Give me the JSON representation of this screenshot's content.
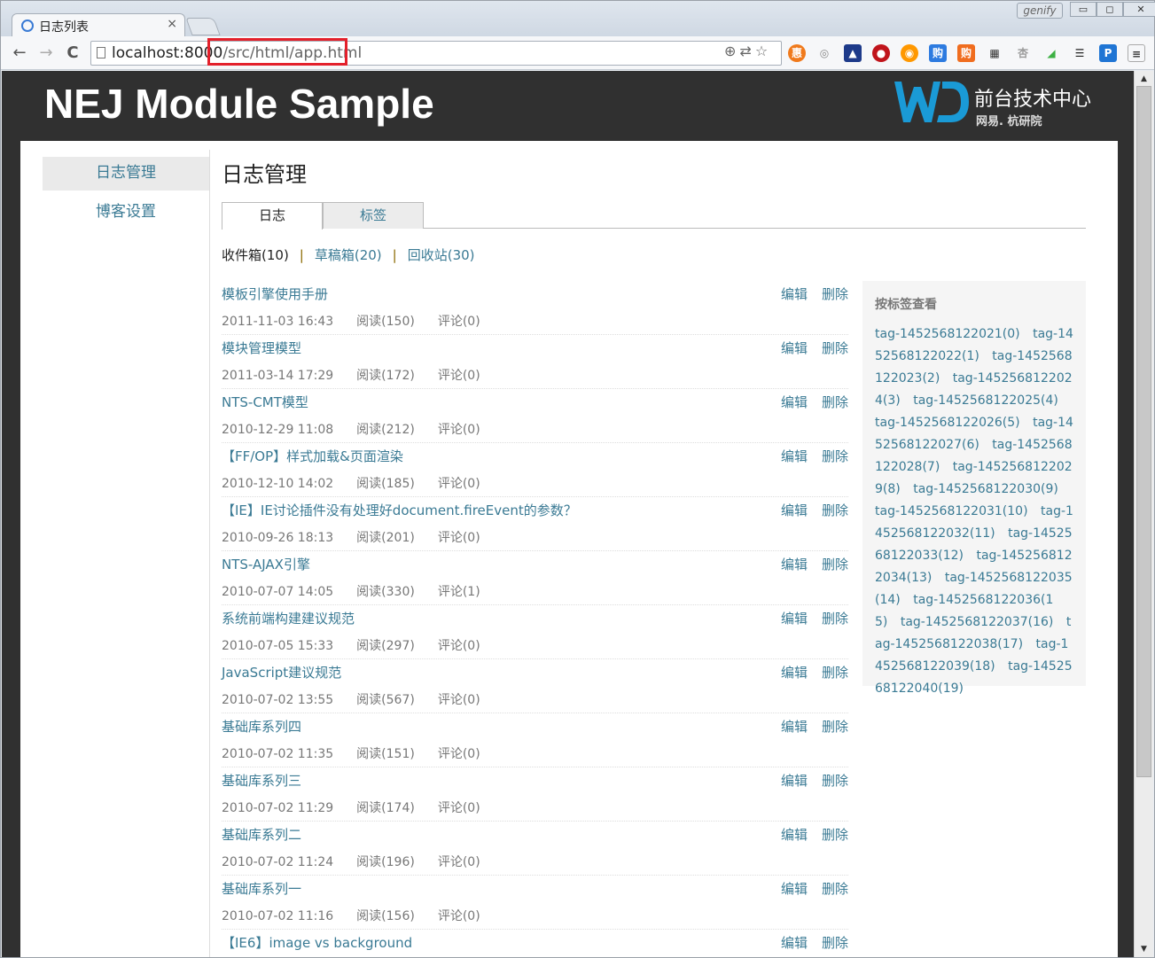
{
  "browser": {
    "tab_title": "日志列表",
    "tab_close": "×",
    "user_badge": "genify",
    "win_min": "▭",
    "win_max": "◻",
    "win_close": "✕",
    "url_host": "localhost:8000",
    "url_path": "/src/html/app.html",
    "back": "←",
    "forward": "→",
    "reload": "C",
    "menu": "≡"
  },
  "banner": {
    "title": "NEJ Module Sample",
    "logo_text": "前台技术中心",
    "logo_sub": "网易. 杭研院"
  },
  "sidebar": {
    "items": [
      {
        "label": "日志管理"
      },
      {
        "label": "博客设置"
      }
    ]
  },
  "main": {
    "title": "日志管理",
    "tabs": [
      {
        "label": "日志"
      },
      {
        "label": "标签"
      }
    ],
    "filters": [
      {
        "label": "收件箱(10)"
      },
      {
        "label": "草稿箱(20)"
      },
      {
        "label": "回收站(30)"
      }
    ],
    "sep": "|",
    "edit_label": "编辑",
    "delete_label": "删除",
    "posts": [
      {
        "title": "模板引擎使用手册",
        "date": "2011-11-03 16:43",
        "reads": "阅读(150)",
        "comments": "评论(0)"
      },
      {
        "title": "模块管理模型",
        "date": "2011-03-14 17:29",
        "reads": "阅读(172)",
        "comments": "评论(0)"
      },
      {
        "title": "NTS-CMT模型",
        "date": "2010-12-29 11:08",
        "reads": "阅读(212)",
        "comments": "评论(0)"
      },
      {
        "title": "【FF/OP】样式加载&页面渲染",
        "date": "2010-12-10 14:02",
        "reads": "阅读(185)",
        "comments": "评论(0)"
      },
      {
        "title": "【IE】IE讨论插件没有处理好document.fireEvent的参数？",
        "date": "2010-09-26 18:13",
        "reads": "阅读(201)",
        "comments": "评论(0)"
      },
      {
        "title": "NTS-AJAX引擎",
        "date": "2010-07-07 14:05",
        "reads": "阅读(330)",
        "comments": "评论(1)"
      },
      {
        "title": "系统前端构建建议规范",
        "date": "2010-07-05 15:33",
        "reads": "阅读(297)",
        "comments": "评论(0)"
      },
      {
        "title": "JavaScript建议规范",
        "date": "2010-07-02 13:55",
        "reads": "阅读(567)",
        "comments": "评论(0)"
      },
      {
        "title": "基础库系列四",
        "date": "2010-07-02 11:35",
        "reads": "阅读(151)",
        "comments": "评论(0)"
      },
      {
        "title": "基础库系列三",
        "date": "2010-07-02 11:29",
        "reads": "阅读(174)",
        "comments": "评论(0)"
      },
      {
        "title": "基础库系列二",
        "date": "2010-07-02 11:24",
        "reads": "阅读(196)",
        "comments": "评论(0)"
      },
      {
        "title": "基础库系列一",
        "date": "2010-07-02 11:16",
        "reads": "阅读(156)",
        "comments": "评论(0)"
      },
      {
        "title": "【IE6】image vs background",
        "date": "",
        "reads": "",
        "comments": ""
      }
    ]
  },
  "tagpanel": {
    "heading": "按标签查看",
    "tags": [
      "tag-1452568122021(0)",
      "tag-1452568122022(1)",
      "tag-1452568122023(2)",
      "tag-1452568122024(3)",
      "tag-1452568122025(4)",
      "tag-1452568122026(5)",
      "tag-1452568122027(6)",
      "tag-1452568122028(7)",
      "tag-1452568122029(8)",
      "tag-1452568122030(9)",
      "tag-1452568122031(10)",
      "tag-1452568122032(11)",
      "tag-1452568122033(12)",
      "tag-1452568122034(13)",
      "tag-1452568122035(14)",
      "tag-1452568122036(15)",
      "tag-1452568122037(16)",
      "tag-1452568122038(17)",
      "tag-1452568122039(18)",
      "tag-1452568122040(19)"
    ]
  },
  "colors": {
    "link": "#3a7a94",
    "banner_bg": "#303030",
    "logo_blue": "#1a9ad6",
    "highlight": "#e3202b"
  }
}
